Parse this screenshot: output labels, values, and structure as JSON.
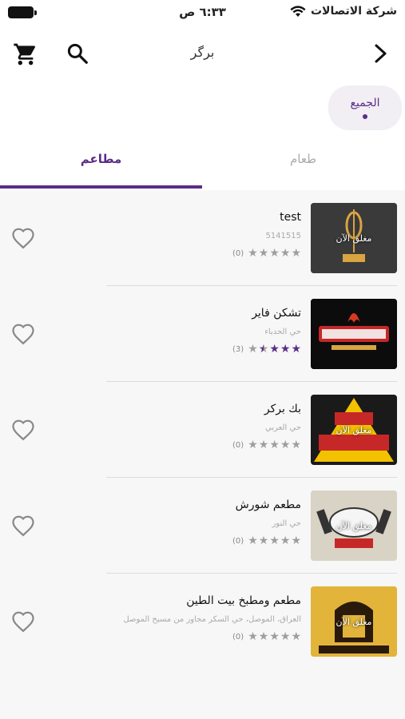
{
  "status_bar": {
    "time": "٦:٣٣ ص",
    "carrier": "شركة الاتصالات"
  },
  "app_bar": {
    "title": "برگر"
  },
  "filter_chip": {
    "label": "الجميع"
  },
  "tabs": [
    {
      "label": "مطاعم",
      "selected": true
    },
    {
      "label": "طعام",
      "selected": false
    }
  ],
  "colors": {
    "accent": "#5a2d86",
    "chip_bg": "#f1eef4",
    "list_bg": "#f7f7f7"
  },
  "restaurants": [
    {
      "name": "test",
      "address": "5141515",
      "rating": 0,
      "rating_count": "(0)",
      "status": "مغلق الآن",
      "image": "big-land-logo"
    },
    {
      "name": "تشكن فاير",
      "address": "حي الحدباء",
      "rating": 3.5,
      "rating_count": "(3)",
      "status": "",
      "image": "chicken-fire-logo"
    },
    {
      "name": "بك بركر",
      "address": "حي العربي",
      "rating": 0,
      "rating_count": "(0)",
      "status": "مغلق الآن",
      "image": "big-burger-logo"
    },
    {
      "name": "مطعم شورش",
      "address": "حي النور",
      "rating": 0,
      "rating_count": "(0)",
      "status": "مغلق الآن",
      "image": "shorsh-logo"
    },
    {
      "name": "مطعم ومطبخ بيت الطين",
      "address": "العراق، الموصل، حي السكر مجاور من مسبح الموصل",
      "rating": 0,
      "rating_count": "(0)",
      "status": "مغلق الآن",
      "image": "beit-al-teen-logo"
    }
  ]
}
